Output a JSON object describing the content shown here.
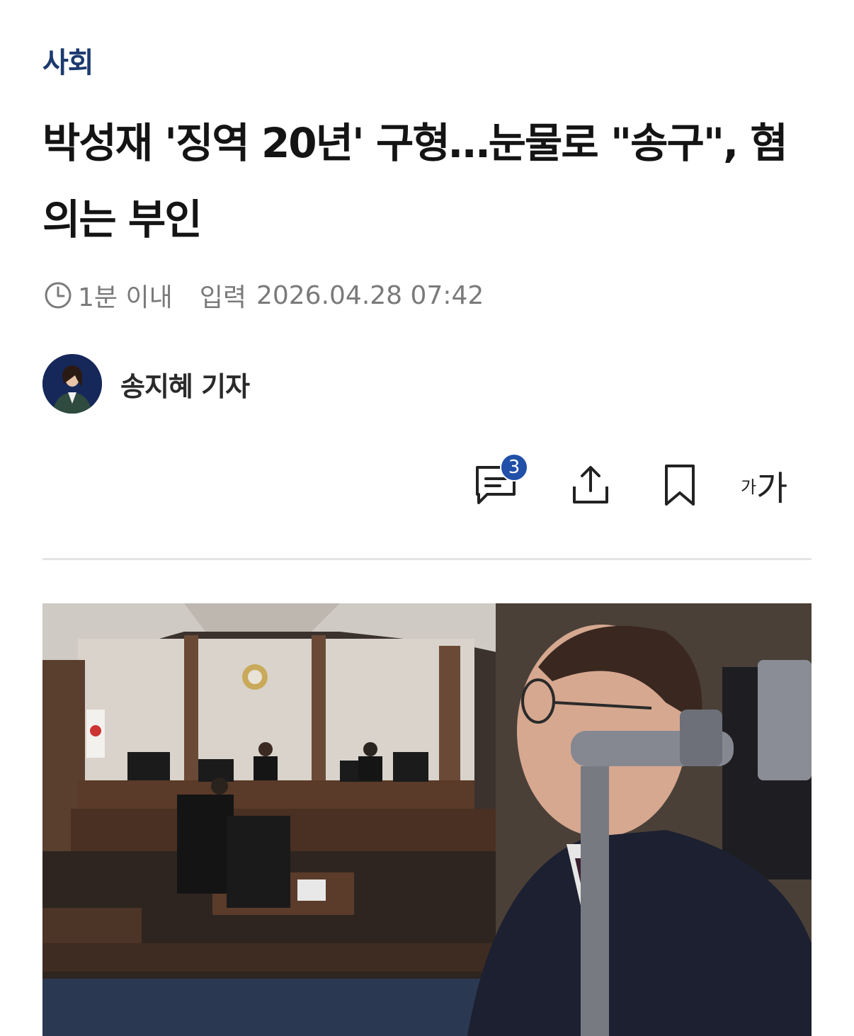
{
  "article": {
    "category": "사회",
    "headline": "박성재 '징역 20년' 구형…눈물로 \"송구\", 혐의는 부인",
    "read_time": "1분 이내",
    "published_label": "입력",
    "published_at": "2026.04.28 07:42"
  },
  "author": {
    "name": "송지혜 기자"
  },
  "toolbar": {
    "comment_count": "3",
    "font_size_small": "가",
    "font_size_large": "가"
  },
  "icons": [
    "clock-icon",
    "comment-icon",
    "share-icon",
    "bookmark-icon"
  ],
  "colors": {
    "category": "#1d3a6e",
    "badge": "#2050a8"
  }
}
